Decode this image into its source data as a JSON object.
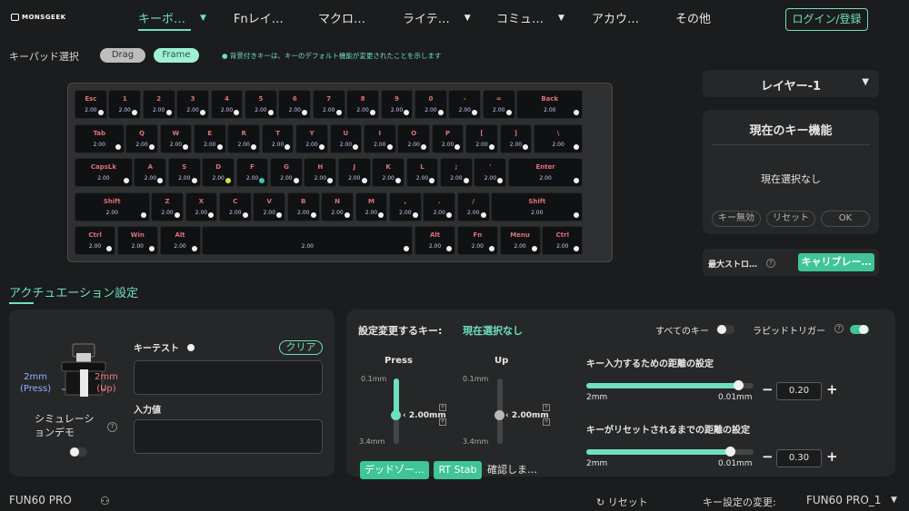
{
  "brand": "MONSGEEK",
  "nav": {
    "items": [
      {
        "label": "キーボ…",
        "dropdown": true
      },
      {
        "label": "Fnレイ…",
        "dropdown": false
      },
      {
        "label": "マクロ…",
        "dropdown": false
      },
      {
        "label": "ライテ…",
        "dropdown": true
      },
      {
        "label": "コミュ…",
        "dropdown": true
      },
      {
        "label": "アカウ…",
        "dropdown": false
      },
      {
        "label": "その他",
        "dropdown": false
      }
    ],
    "login": "ログイン/登録"
  },
  "keypad": {
    "label": "キーパッド選択",
    "drag": "Drag",
    "frame": "Frame",
    "hint": "● 背景付きキーは、キーのデフォルト機能が変更されたことを示します"
  },
  "keyboard": {
    "rows": [
      [
        [
          "Esc",
          "2.00"
        ],
        [
          "1",
          "2.00"
        ],
        [
          "2",
          "2.00"
        ],
        [
          "3",
          "2.00"
        ],
        [
          "4",
          "2.00"
        ],
        [
          "5",
          "2.00"
        ],
        [
          "6",
          "2.00"
        ],
        [
          "7",
          "2.00"
        ],
        [
          "8",
          "2.00"
        ],
        [
          "9",
          "2.00"
        ],
        [
          "0",
          "2.00"
        ],
        [
          "-",
          "2.00"
        ],
        [
          "=",
          "2.00"
        ],
        [
          "Back",
          "2.00"
        ]
      ],
      [
        [
          "Tab",
          "2.00"
        ],
        [
          "Q",
          "2.00"
        ],
        [
          "W",
          "2.00"
        ],
        [
          "E",
          "2.00"
        ],
        [
          "R",
          "2.00"
        ],
        [
          "T",
          "2.00"
        ],
        [
          "Y",
          "2.00"
        ],
        [
          "U",
          "2.00"
        ],
        [
          "I",
          "2.00"
        ],
        [
          "O",
          "2.00"
        ],
        [
          "P",
          "2.00"
        ],
        [
          "[",
          "2.00"
        ],
        [
          "]",
          "2.00"
        ],
        [
          "\\",
          "2.00"
        ]
      ],
      [
        [
          "CapsLk",
          "2.00"
        ],
        [
          "A",
          "2.00"
        ],
        [
          "S",
          "2.00"
        ],
        [
          "D",
          "2.00"
        ],
        [
          "F",
          "2.00"
        ],
        [
          "G",
          "2.00"
        ],
        [
          "H",
          "2.00"
        ],
        [
          "J",
          "2.00"
        ],
        [
          "K",
          "2.00"
        ],
        [
          "L",
          "2.00"
        ],
        [
          ";",
          "2.00"
        ],
        [
          "'",
          "2.00"
        ],
        [
          "Enter",
          "2.00"
        ]
      ],
      [
        [
          "Shift",
          "2.00"
        ],
        [
          "Z",
          "2.00"
        ],
        [
          "X",
          "2.00"
        ],
        [
          "C",
          "2.00"
        ],
        [
          "V",
          "2.00"
        ],
        [
          "B",
          "2.00"
        ],
        [
          "N",
          "2.00"
        ],
        [
          "M",
          "2.00"
        ],
        [
          ",",
          "2.00"
        ],
        [
          ".",
          "2.00"
        ],
        [
          "/",
          "2.00"
        ],
        [
          "Shift",
          "2.00"
        ]
      ],
      [
        [
          "Ctrl",
          "2.00"
        ],
        [
          "Win",
          "2.00"
        ],
        [
          "Alt",
          "2.00"
        ],
        [
          "",
          "2.00"
        ],
        [
          "Alt",
          "2.00"
        ],
        [
          "Fn",
          "2.00"
        ],
        [
          "Menu",
          "2.00"
        ],
        [
          "Ctrl",
          "2.00"
        ]
      ]
    ],
    "accent_dot_colors": {
      "d": "#d7e04a",
      "f": "#3fc5b6"
    }
  },
  "layer": {
    "label": "レイヤー-1"
  },
  "current_func": {
    "title": "現在のキー機能",
    "none": "現在選択なし",
    "disable": "キー無効",
    "reset": "リセット",
    "ok": "OK"
  },
  "stroke": {
    "label": "最大ストロ…",
    "calibrate": "キャリブレー…"
  },
  "actuation": {
    "title": "アクチュエーション設定"
  },
  "left": {
    "press_mm": "2mm",
    "press_label": "(Press)",
    "up_mm": "2mm",
    "up_label": "(Up)",
    "sim_line1": "シミュレーシ",
    "sim_line2": "ョンデモ",
    "keytest": "キーテスト",
    "clear": "クリア",
    "input_value": "入力値"
  },
  "right": {
    "setting_key": "設定変更するキー:",
    "setting_value": "現在選択なし",
    "all_keys": "すべてのキー",
    "rapid_trigger": "ラピッドトリガー",
    "press": {
      "label": "Press",
      "top": "0.1mm",
      "bottom": "3.4mm",
      "value": "2.00mm",
      "fraction": 0.55
    },
    "up": {
      "label": "Up",
      "top": "0.1mm",
      "bottom": "3.4mm",
      "value": "2.00mm",
      "fraction": 0.55
    },
    "deadzone": "デッドゾー…",
    "rt_stab": "RT Stab",
    "confirm": "確認しま…",
    "actuate": {
      "title": "キー入力するための距離の設定",
      "min": "2mm",
      "max": "0.01mm",
      "value": "0.20",
      "fraction": 0.91
    },
    "release": {
      "title": "キーがリセットされるまでの距離の設定",
      "min": "2mm",
      "max": "0.01mm",
      "value": "0.30",
      "fraction": 0.86
    }
  },
  "footer": {
    "model": "FUN60 PRO",
    "reset": "リセット",
    "change": "キー設定の変更:",
    "profile": "FUN60 PRO_1"
  },
  "colors": {
    "accent": "#6fe0bd",
    "button": "#3fc596",
    "label_red": "#e0707a"
  }
}
